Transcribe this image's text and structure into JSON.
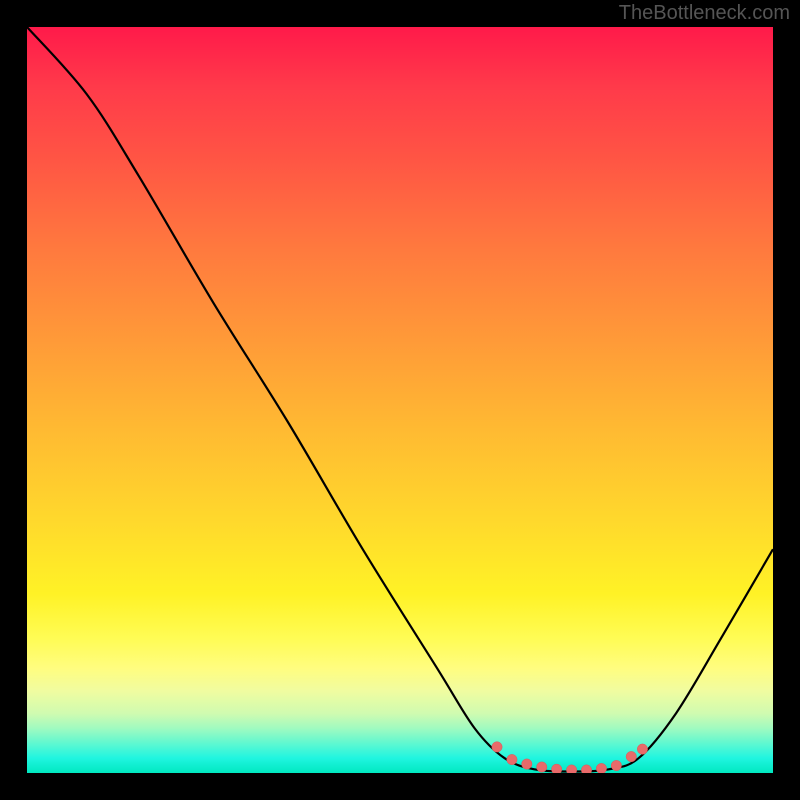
{
  "watermark": "TheBottleneck.com",
  "chart_data": {
    "type": "line",
    "title": "",
    "xlabel": "",
    "ylabel": "",
    "xlim": [
      0,
      100
    ],
    "ylim": [
      0,
      100
    ],
    "series": [
      {
        "name": "curve",
        "points": [
          {
            "x": 0,
            "y": 100
          },
          {
            "x": 8,
            "y": 91
          },
          {
            "x": 15,
            "y": 80
          },
          {
            "x": 25,
            "y": 63
          },
          {
            "x": 35,
            "y": 47
          },
          {
            "x": 45,
            "y": 30
          },
          {
            "x": 55,
            "y": 14
          },
          {
            "x": 60,
            "y": 6
          },
          {
            "x": 64,
            "y": 2
          },
          {
            "x": 68,
            "y": 0.5
          },
          {
            "x": 73,
            "y": 0.2
          },
          {
            "x": 78,
            "y": 0.5
          },
          {
            "x": 82,
            "y": 2
          },
          {
            "x": 87,
            "y": 8
          },
          {
            "x": 93,
            "y": 18
          },
          {
            "x": 100,
            "y": 30
          }
        ]
      }
    ],
    "markers": [
      {
        "x": 63,
        "y": 3.5
      },
      {
        "x": 65,
        "y": 1.8
      },
      {
        "x": 67,
        "y": 1.2
      },
      {
        "x": 69,
        "y": 0.8
      },
      {
        "x": 71,
        "y": 0.5
      },
      {
        "x": 73,
        "y": 0.4
      },
      {
        "x": 75,
        "y": 0.4
      },
      {
        "x": 77,
        "y": 0.6
      },
      {
        "x": 79,
        "y": 1.0
      },
      {
        "x": 81,
        "y": 2.2
      },
      {
        "x": 82.5,
        "y": 3.2
      }
    ],
    "gradient_stops": [
      {
        "pos": 0,
        "color": "#ff1a4a"
      },
      {
        "pos": 50,
        "color": "#ffba32"
      },
      {
        "pos": 80,
        "color": "#fffc55"
      },
      {
        "pos": 100,
        "color": "#00e8c0"
      }
    ]
  }
}
